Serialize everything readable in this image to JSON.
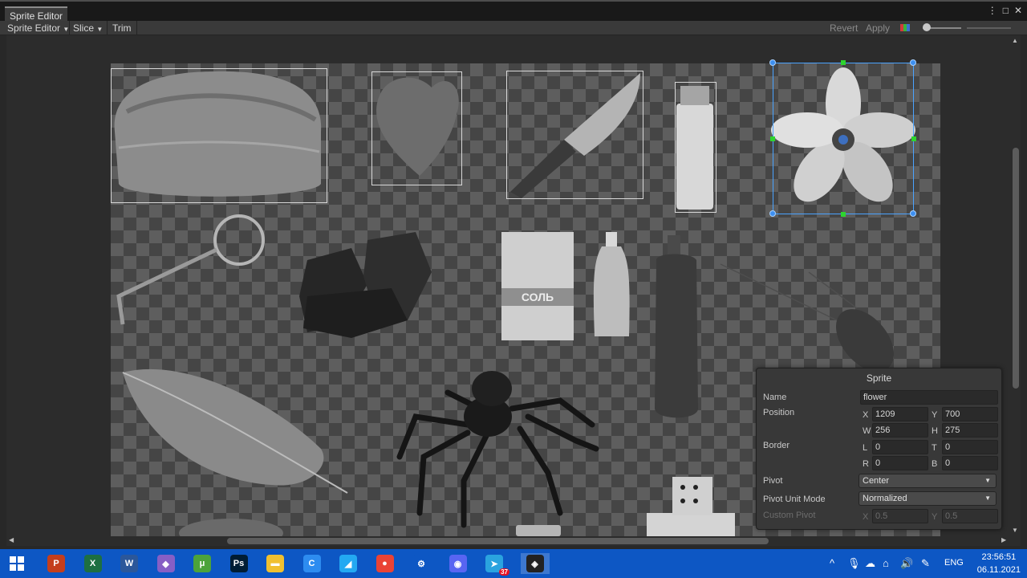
{
  "window": {
    "title": "Sprite Editor",
    "controls": [
      "⋮",
      "□",
      "✕"
    ]
  },
  "toolbar": {
    "sprite_editor_menu": "Sprite Editor",
    "slice_menu": "Slice",
    "trim": "Trim",
    "revert": "Revert",
    "apply": "Apply"
  },
  "panel": {
    "title": "Sprite",
    "name_label": "Name",
    "name_value": "flower",
    "position_label": "Position",
    "x_label": "X",
    "x_value": "1209",
    "y_label": "Y",
    "y_value": "700",
    "w_label": "W",
    "w_value": "256",
    "h_label": "H",
    "h_value": "275",
    "border_label": "Border",
    "l_label": "L",
    "l_value": "0",
    "t_label": "T",
    "t_value": "0",
    "r_label": "R",
    "r_value": "0",
    "b_label": "B",
    "b_value": "0",
    "pivot_label": "Pivot",
    "pivot_value": "Center",
    "pivot_unit_label": "Pivot Unit Mode",
    "pivot_unit_value": "Normalized",
    "custom_pivot_label": "Custom Pivot",
    "cp_x_label": "X",
    "cp_x_value": "0.5",
    "cp_y_label": "Y",
    "cp_y_value": "0.5"
  },
  "taskbar": {
    "apps": [
      {
        "name": "powerpoint-icon",
        "glyph": "P",
        "color": "#c43e1c"
      },
      {
        "name": "excel-icon",
        "glyph": "X",
        "color": "#1d6f42"
      },
      {
        "name": "word-icon",
        "glyph": "W",
        "color": "#2b579a"
      },
      {
        "name": "visual-studio-icon",
        "glyph": "◆",
        "color": "#865fc5"
      },
      {
        "name": "utorrent-icon",
        "glyph": "μ",
        "color": "#4ca33a"
      },
      {
        "name": "photoshop-icon",
        "glyph": "Ps",
        "color": "#001d34"
      },
      {
        "name": "file-explorer-icon",
        "glyph": "▬",
        "color": "#f0c030"
      },
      {
        "name": "browser-c-icon",
        "glyph": "C",
        "color": "#2d8cf0"
      },
      {
        "name": "vscode-icon",
        "glyph": "◢",
        "color": "#23a9f2"
      },
      {
        "name": "chrome-icon",
        "glyph": "●",
        "color": "#ea4335"
      },
      {
        "name": "settings-icon",
        "glyph": "⚙",
        "color": "#0d57c4"
      },
      {
        "name": "discord-icon",
        "glyph": "◉",
        "color": "#5865f2"
      },
      {
        "name": "telegram-icon",
        "glyph": "➤",
        "color": "#2aa3df"
      },
      {
        "name": "unity-icon",
        "glyph": "◈",
        "color": "#222222"
      }
    ],
    "telegram_badge": "37",
    "lang": "ENG",
    "time": "23:56:51",
    "date": "06.11.2021"
  }
}
